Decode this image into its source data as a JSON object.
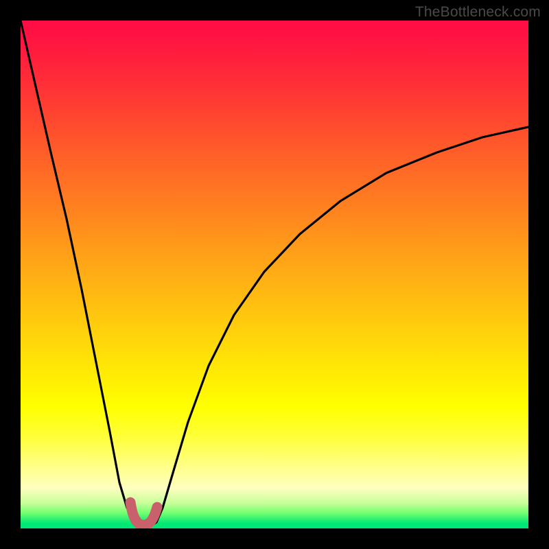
{
  "attribution": "TheBottleneck.com",
  "colors": {
    "frame": "#000000",
    "curve": "#000000",
    "rounded_tip": "#c9616c",
    "gradient_top": "#ff0b46",
    "gradient_bottom": "#00e874"
  },
  "chart_data": {
    "type": "line",
    "title": "",
    "xlabel": "",
    "ylabel": "",
    "xlim": [
      0,
      1
    ],
    "ylim": [
      0,
      1
    ],
    "y_axis_note": "larger y plotted toward top; curve minimum touches bottom (y≈0); left edge reaches y≈1; right edge reaches y≈0.79",
    "series": [
      {
        "name": "bottleneck-curve",
        "x": [
          0.0,
          0.03,
          0.06,
          0.09,
          0.12,
          0.15,
          0.175,
          0.195,
          0.21,
          0.225,
          0.235,
          0.245,
          0.255,
          0.267,
          0.28,
          0.3,
          0.33,
          0.37,
          0.42,
          0.48,
          0.55,
          0.63,
          0.72,
          0.82,
          0.91,
          1.0
        ],
        "y": [
          1.0,
          0.87,
          0.74,
          0.61,
          0.47,
          0.32,
          0.19,
          0.09,
          0.04,
          0.012,
          0.004,
          0.002,
          0.004,
          0.012,
          0.04,
          0.11,
          0.21,
          0.32,
          0.42,
          0.505,
          0.58,
          0.645,
          0.7,
          0.74,
          0.77,
          0.79
        ]
      }
    ],
    "annotations": [
      {
        "name": "rounded-minimum-marker",
        "shape": "u-shape",
        "approx_x_range": [
          0.215,
          0.268
        ],
        "approx_y": 0.02,
        "stroke": "#c9616c",
        "stroke_width_px": 14
      }
    ]
  }
}
